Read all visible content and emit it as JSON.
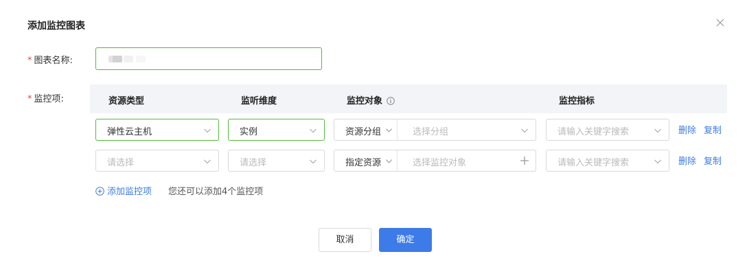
{
  "dialog": {
    "title": "添加监控图表",
    "close_icon": "close-icon"
  },
  "form": {
    "required_mark": "*",
    "name_label": "图表名称:",
    "items_label": "监控项:"
  },
  "table": {
    "headers": {
      "resource_type": "资源类型",
      "listen_dimension": "监听维度",
      "monitor_target": "监控对象",
      "monitor_metric": "监控指标"
    },
    "rows": [
      {
        "resource_type": {
          "value": "弹性云主机",
          "placeholder": ""
        },
        "dimension": {
          "value": "实例",
          "placeholder": ""
        },
        "target_mode": "资源分组",
        "target_placeholder": "选择分组",
        "target_action_icon": "chevron-down-icon",
        "metric_placeholder": "请输入关键字搜索",
        "delete": "删除",
        "copy": "复制"
      },
      {
        "resource_type": {
          "value": "",
          "placeholder": "请选择"
        },
        "dimension": {
          "value": "",
          "placeholder": "请选择"
        },
        "target_mode": "指定资源",
        "target_placeholder": "选择监控对象",
        "target_action_icon": "plus-icon",
        "metric_placeholder": "请输入关键字搜索",
        "delete": "删除",
        "copy": "复制"
      }
    ]
  },
  "add_item": {
    "label": "添加监控项",
    "tip": "您还可以添加4个监控项"
  },
  "buttons": {
    "cancel": "取消",
    "confirm": "确定"
  },
  "colors": {
    "accent": "#3d7be8",
    "active_border": "#52b93b",
    "required": "#e64a3c",
    "header_bg": "#f3f4f7"
  }
}
